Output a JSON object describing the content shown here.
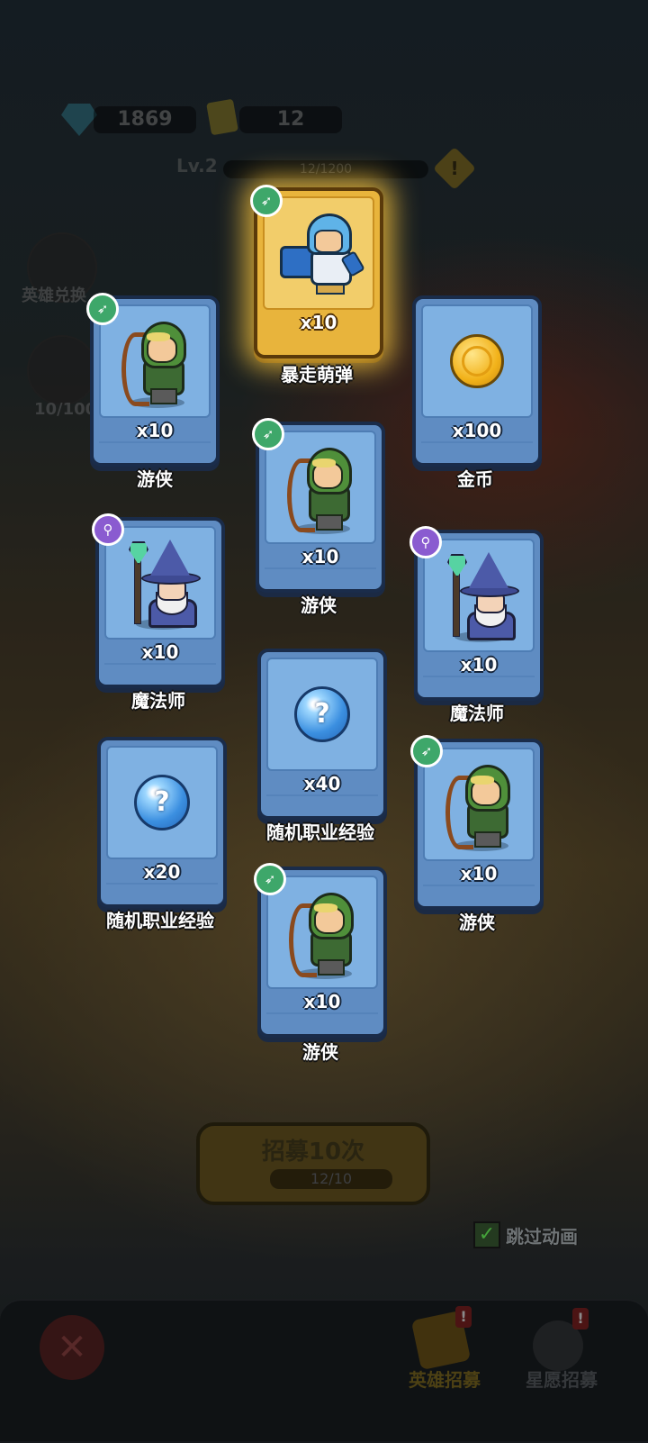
{
  "header": {
    "gems": "1869",
    "tickets": "12",
    "level": "Lv.2",
    "level_progress": "12/1200",
    "level_progress_fraction": 0.01,
    "warn_icon": "!"
  },
  "side": {
    "hero_exchange_label": "英雄兑换",
    "wish_count": "10/100"
  },
  "cards": [
    {
      "id": "c1",
      "hero": "gunner",
      "badge": "ranger-class",
      "qty": "x10",
      "name": "暴走萌弹",
      "rarity": "gold"
    },
    {
      "id": "c2",
      "hero": "ranger",
      "badge": "ranger-class",
      "qty": "x10",
      "name": "游侠",
      "rarity": "blue"
    },
    {
      "id": "c3",
      "hero": "coin",
      "badge": "",
      "qty": "x100",
      "name": "金币",
      "rarity": "blue"
    },
    {
      "id": "c4",
      "hero": "ranger",
      "badge": "ranger-class",
      "qty": "x10",
      "name": "游侠",
      "rarity": "blue"
    },
    {
      "id": "c5",
      "hero": "mage",
      "badge": "mage-class",
      "qty": "x10",
      "name": "魔法师",
      "rarity": "blue"
    },
    {
      "id": "c6",
      "hero": "mage",
      "badge": "mage-class",
      "qty": "x10",
      "name": "魔法师",
      "rarity": "blue"
    },
    {
      "id": "c7",
      "hero": "exp-orb",
      "badge": "",
      "qty": "x40",
      "name": "随机职业经验",
      "rarity": "blue"
    },
    {
      "id": "c8",
      "hero": "exp-orb",
      "badge": "",
      "qty": "x20",
      "name": "随机职业经验",
      "rarity": "blue"
    },
    {
      "id": "c9",
      "hero": "ranger",
      "badge": "ranger-class",
      "qty": "x10",
      "name": "游侠",
      "rarity": "blue"
    },
    {
      "id": "c10",
      "hero": "ranger",
      "badge": "ranger-class",
      "qty": "x10",
      "name": "游侠",
      "rarity": "blue"
    }
  ],
  "recruit": {
    "label": "招募10次",
    "count": "12/10"
  },
  "skip": {
    "label": "跳过动画",
    "checked": true
  },
  "tabs": {
    "hero_recruit": "英雄招募",
    "wish_recruit": "星愿招募"
  },
  "colors": {
    "card_blue": "#5f8cc2",
    "card_gold": "#e8b43c",
    "ranger_badge": "#3ea76a",
    "mage_badge": "#8a5bd0"
  }
}
